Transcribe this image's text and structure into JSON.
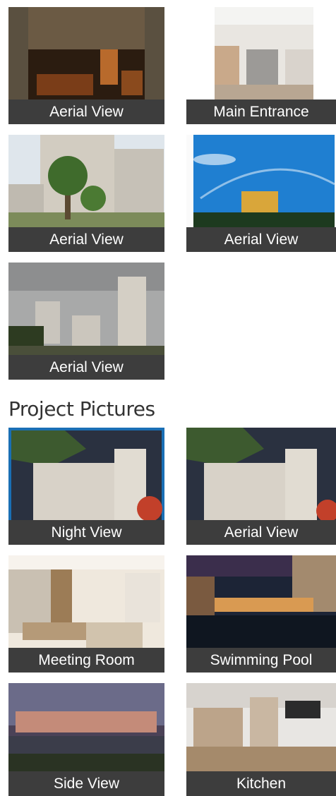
{
  "gallery_top": [
    {
      "caption": "Aerial View"
    },
    {
      "caption": "Main Entrance"
    },
    {
      "caption": "Aerial View"
    },
    {
      "caption": "Aerial View"
    },
    {
      "caption": "Aerial View"
    }
  ],
  "project_section": {
    "title": "Project Pictures"
  },
  "gallery_project": [
    {
      "caption": "Night View"
    },
    {
      "caption": "Aerial View"
    },
    {
      "caption": "Meeting Room"
    },
    {
      "caption": "Swimming Pool"
    },
    {
      "caption": "Side View"
    },
    {
      "caption": "Kitchen"
    }
  ]
}
